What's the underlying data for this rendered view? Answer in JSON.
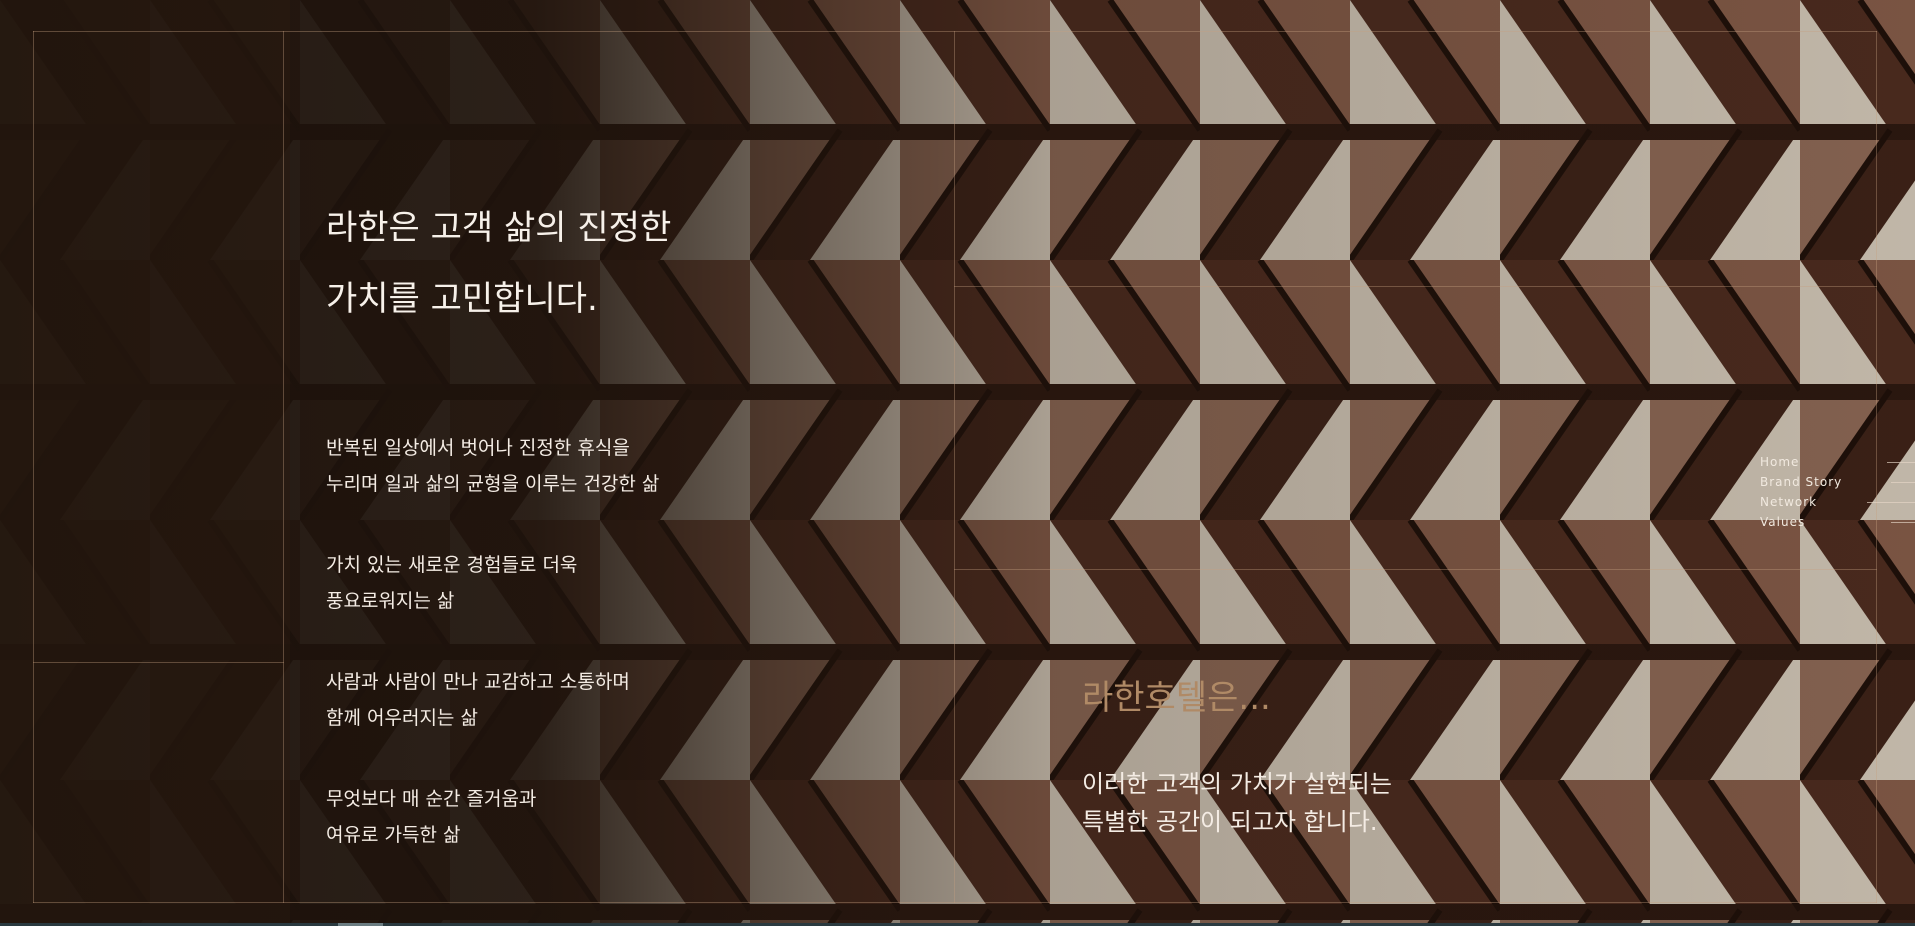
{
  "headline": {
    "line1": "라한은 고객 삶의 진정한",
    "line2": "가치를 고민합니다."
  },
  "values": [
    {
      "line1": "반복된 일상에서 벗어나 진정한 휴식을",
      "line2": "누리며 일과 삶의 균형을 이루는 건강한 삶"
    },
    {
      "line1": "가치 있는 새로운 경험들로 더욱",
      "line2": "풍요로워지는 삶"
    },
    {
      "line1": "사람과 사람이 만나 교감하고 소통하며",
      "line2": "함께 어우러지는 삶"
    },
    {
      "line1": "무엇보다 매 순간 즐거움과",
      "line2": "여유로 가득한 삶"
    }
  ],
  "brand": {
    "heading": "라한호텔은...",
    "line1": "이러한 고객의 가치가 실현되는",
    "line2": "특별한 공간이 되고자 합니다."
  },
  "side_nav": {
    "items": [
      "Home",
      "Brand Story",
      "Network",
      "Values"
    ]
  },
  "colors": {
    "accent": "#b08a66",
    "frame_line": "#c4a080",
    "text": "#f4ece4",
    "background": "#1a100a"
  },
  "icons": {
    "background": "wooden-lattice-image"
  }
}
